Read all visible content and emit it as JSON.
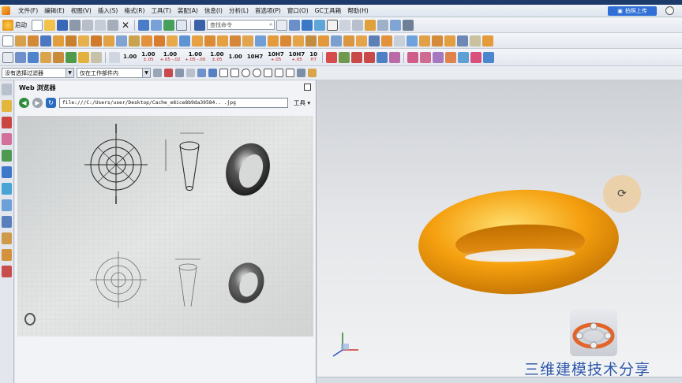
{
  "menu": {
    "items": [
      "文件(F)",
      "编辑(E)",
      "视图(V)",
      "插入(S)",
      "格式(R)",
      "工具(T)",
      "装配(A)",
      "信息(I)",
      "分析(L)",
      "首选项(P)",
      "窗口(O)",
      "GC工具箱",
      "帮助(H)"
    ],
    "upload_label": "拍照上传"
  },
  "toolbar": {
    "start_label": "启动",
    "command_search_placeholder": "查找命令",
    "dim_labels": [
      {
        "main": "1.00",
        "sub": ""
      },
      {
        "main": "1.00",
        "sub": "±.05"
      },
      {
        "main": "1.00",
        "sub": "+.05 -.02"
      },
      {
        "main": "1.00",
        "sub": "+.05 -.00"
      },
      {
        "main": "1.00",
        "sub": "±.05"
      },
      {
        "main": "1.00",
        "sub": ""
      },
      {
        "main": "10H7",
        "sub": ""
      },
      {
        "main": "10H7",
        "sub": "+.05"
      },
      {
        "main": "10H7",
        "sub": "+.05"
      },
      {
        "main": "10",
        "sub": "H7"
      }
    ]
  },
  "filterbar": {
    "selection_filter": "没有选择过滤器",
    "scope_filter": "仅在工作部件内"
  },
  "web_panel": {
    "title": "Web 浏览器",
    "url": "file:///C:/Users/user/Desktop/Cache_e8ice8b9da39584.. .jpg",
    "tools_label": "工具"
  },
  "viewport": {
    "watermark": "三维建模技术分享",
    "model_color": "#f5a00f"
  }
}
